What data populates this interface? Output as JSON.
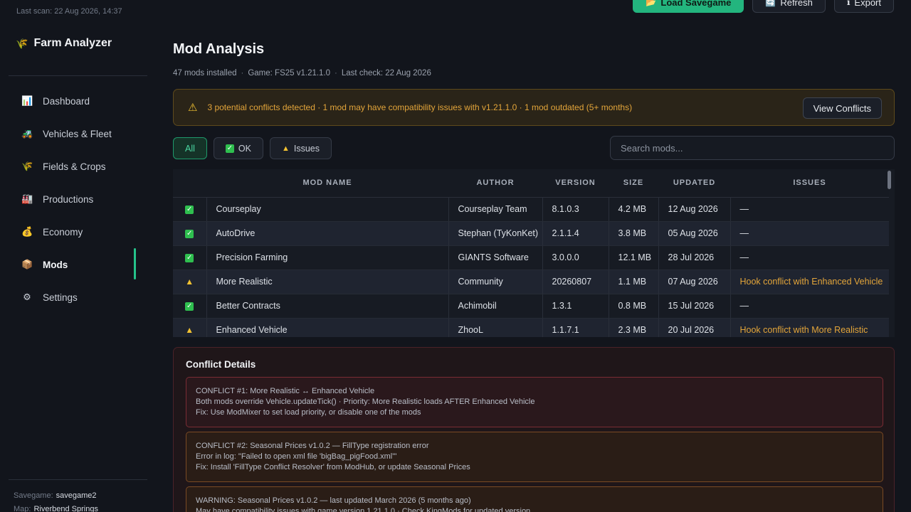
{
  "sidebar": {
    "last_scan": "Last scan: 22 Aug 2026, 14:37",
    "brand_icon": "🌾",
    "brand": "Farm Analyzer",
    "items": [
      {
        "icon": "📊",
        "label": "Dashboard",
        "name": "dashboard"
      },
      {
        "icon": "🚜",
        "label": "Vehicles & Fleet",
        "name": "vehicles-fleet"
      },
      {
        "icon": "🌾",
        "label": "Fields & Crops",
        "name": "fields-crops"
      },
      {
        "icon": "🏭",
        "label": "Productions",
        "name": "productions"
      },
      {
        "icon": "💰",
        "label": "Economy",
        "name": "economy"
      },
      {
        "icon": "📦",
        "label": "Mods",
        "name": "mods"
      },
      {
        "icon": "⚙",
        "label": "Settings",
        "name": "settings"
      }
    ],
    "footer": {
      "savegame_label": "Savegame:",
      "savegame_value": "savegame2",
      "map_label": "Map:",
      "map_value": "Riverbend Springs"
    }
  },
  "toolbar": {
    "load_label": "Load Savegame",
    "load_icon": "📂",
    "refresh_label": "Refresh",
    "refresh_icon": "🔄",
    "export_label": "Export",
    "export_icon": "ℹ"
  },
  "page": {
    "title": "Mod Analysis",
    "meta": [
      "47 mods installed",
      "Game: FS25 v1.21.1.0",
      "Last check: 22 Aug 2026"
    ]
  },
  "alert": {
    "icon": "⚠",
    "text": "3 potential conflicts detected · 1 mod may have compatibility issues with v1.21.1.0 · 1 mod outdated (5+ months)",
    "button": "View Conflicts"
  },
  "filters": {
    "all": "All",
    "ok": "OK",
    "issues": "Issues"
  },
  "search": {
    "placeholder": "Search mods..."
  },
  "table": {
    "headers": [
      "MOD NAME",
      "AUTHOR",
      "VERSION",
      "SIZE",
      "UPDATED",
      "ISSUES"
    ],
    "rows": [
      {
        "status": "ok",
        "name": "Courseplay",
        "author": "Courseplay Team",
        "version": "8.1.0.3",
        "size": "4.2 MB",
        "updated": "12 Aug 2026",
        "issues": "—"
      },
      {
        "status": "ok",
        "name": "AutoDrive",
        "author": "Stephan (TyKonKet)",
        "version": "2.1.1.4",
        "size": "3.8 MB",
        "updated": "05 Aug 2026",
        "issues": "—"
      },
      {
        "status": "ok",
        "name": "Precision Farming",
        "author": "GIANTS Software",
        "version": "3.0.0.0",
        "size": "12.1 MB",
        "updated": "28 Jul 2026",
        "issues": "—"
      },
      {
        "status": "warn",
        "name": "More Realistic",
        "author": "Community",
        "version": "20260807",
        "size": "1.1 MB",
        "updated": "07 Aug 2026",
        "issues": "Hook conflict with Enhanced Vehicle"
      },
      {
        "status": "ok",
        "name": "Better Contracts",
        "author": "Achimobil",
        "version": "1.3.1",
        "size": "0.8 MB",
        "updated": "15 Jul 2026",
        "issues": "—"
      },
      {
        "status": "warn",
        "name": "Enhanced Vehicle",
        "author": "ZhooL",
        "version": "1.1.7.1",
        "size": "2.3 MB",
        "updated": "20 Jul 2026",
        "issues": "Hook conflict with More Realistic"
      }
    ]
  },
  "conflicts": {
    "title": "Conflict Details",
    "items": [
      {
        "style": "red",
        "lines": [
          "CONFLICT #1: More Realistic ↔ Enhanced Vehicle",
          "Both mods override Vehicle.updateTick() · Priority: More Realistic loads AFTER Enhanced Vehicle",
          "Fix: Use ModMixer to set load priority, or disable one of the mods"
        ]
      },
      {
        "style": "orange",
        "lines": [
          "CONFLICT #2: Seasonal Prices v1.0.2 — FillType registration error",
          "Error in log: \"Failed to open xml file 'bigBag_pigFood.xml'\"",
          "Fix: Install 'FillType Conflict Resolver' from ModHub, or update Seasonal Prices"
        ]
      },
      {
        "style": "orange",
        "lines": [
          "WARNING: Seasonal Prices v1.0.2 — last updated March 2026 (5 months ago)",
          "May have compatibility issues with game version 1.21.1.0 · Check KingMods for updated version"
        ]
      }
    ]
  },
  "colors": {
    "accent": "#23b57e",
    "warning": "#e3a53a",
    "danger": "#7a2c34"
  }
}
